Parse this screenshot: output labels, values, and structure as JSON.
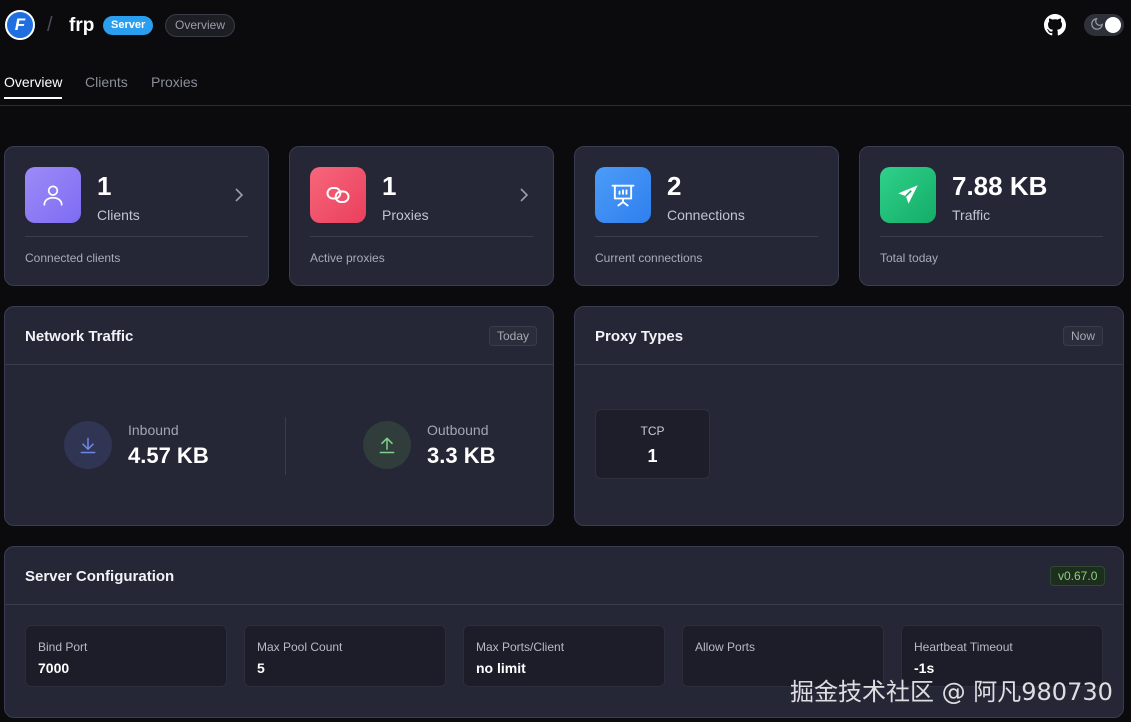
{
  "header": {
    "logo_letter": "F",
    "app_name": "frp",
    "server_badge": "Server",
    "page_badge": "Overview"
  },
  "tabs": [
    {
      "label": "Overview",
      "active": true
    },
    {
      "label": "Clients",
      "active": false
    },
    {
      "label": "Proxies",
      "active": false
    }
  ],
  "stats": [
    {
      "value": "1",
      "label": "Clients",
      "sub": "Connected clients",
      "icon": "user-icon",
      "color": "#8b7cf6",
      "has_link": true
    },
    {
      "value": "1",
      "label": "Proxies",
      "sub": "Active proxies",
      "icon": "link-icon",
      "color": "#f0566d",
      "has_link": true
    },
    {
      "value": "2",
      "label": "Connections",
      "sub": "Current connections",
      "icon": "presentation-icon",
      "color": "#3b8ef5",
      "has_link": false
    },
    {
      "value": "7.88 KB",
      "label": "Traffic",
      "sub": "Total today",
      "icon": "send-icon",
      "color": "#22c17a",
      "has_link": false
    }
  ],
  "network_traffic": {
    "title": "Network Traffic",
    "tag": "Today",
    "inbound": {
      "label": "Inbound",
      "value": "4.57 KB"
    },
    "outbound": {
      "label": "Outbound",
      "value": "3.3 KB"
    }
  },
  "proxy_types": {
    "title": "Proxy Types",
    "tag": "Now",
    "items": [
      {
        "name": "TCP",
        "count": "1"
      }
    ]
  },
  "server_config": {
    "title": "Server Configuration",
    "version": "v0.67.0",
    "items": [
      {
        "key": "Bind Port",
        "value": "7000"
      },
      {
        "key": "Max Pool Count",
        "value": "5"
      },
      {
        "key": "Max Ports/Client",
        "value": "no limit"
      },
      {
        "key": "Allow Ports",
        "value": ""
      },
      {
        "key": "Heartbeat Timeout",
        "value": "-1s"
      }
    ]
  },
  "watermark": "掘金技术社区 @ 阿凡980730"
}
